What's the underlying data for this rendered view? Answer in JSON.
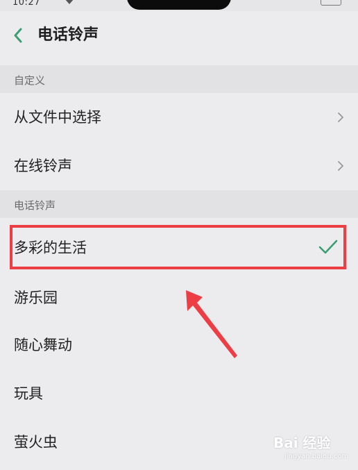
{
  "status_bar": {
    "time": "10:27"
  },
  "header": {
    "title": "电话铃声",
    "back_icon": "back-chevron-icon"
  },
  "sections": {
    "custom": {
      "title": "自定义",
      "items": [
        {
          "label": "从文件中选择",
          "icon": "chevron-right-icon"
        },
        {
          "label": "在线铃声",
          "icon": "chevron-right-icon"
        }
      ]
    },
    "ringtones": {
      "title": "电话铃声",
      "items": [
        {
          "label": "多彩的生活",
          "selected": true,
          "icon": "checkmark-icon"
        },
        {
          "label": "游乐园"
        },
        {
          "label": "随心舞动"
        },
        {
          "label": "玩具"
        },
        {
          "label": "萤火虫"
        }
      ]
    }
  },
  "annotation": {
    "highlight_color": "#ee3e45"
  },
  "watermark": {
    "brand": "Bai 经验",
    "url": "jingyan.baidu.com"
  },
  "colors": {
    "accent": "#3a9e72",
    "background": "#ececef",
    "section_bg": "#e2e2e5"
  }
}
